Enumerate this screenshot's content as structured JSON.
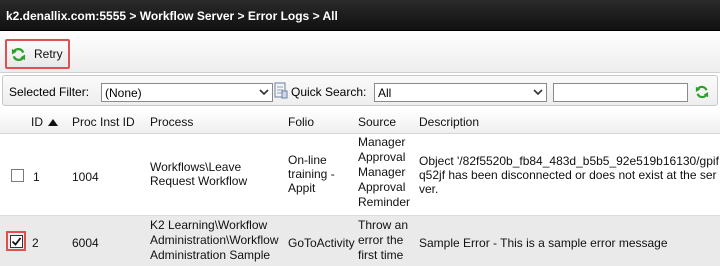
{
  "breadcrumb": "k2.denallix.com:5555 > Workflow Server > Error Logs > All",
  "toolbar": {
    "retry_label": "Retry"
  },
  "filter": {
    "selected_filter_label": "Selected Filter:",
    "selected_filter_value": "(None)",
    "quick_search_label": "Quick Search:",
    "quick_search_scope": "All",
    "quick_search_text": ""
  },
  "columns": [
    "ID",
    "Proc Inst ID",
    "Process",
    "Folio",
    "Source",
    "Description"
  ],
  "rows": [
    {
      "checked": false,
      "id": "1",
      "proc_inst_id": "1004",
      "process": "Workflows\\Leave Request Workflow",
      "folio": "On-line training - Appit",
      "source": "Manager Approval Manager Approval Reminder",
      "description": "Object '/82f5520b_fb84_483d_b5b5_92e519b16130/gpifq52jf has been disconnected or does not exist at the server."
    },
    {
      "checked": true,
      "id": "2",
      "proc_inst_id": "6004",
      "process": "K2 Learning\\Workflow Administration\\Workflow Administration Sample",
      "folio": "GoToActivity",
      "source": "Throw an error the first time",
      "description": "Sample Error - This is a sample error message"
    }
  ],
  "colors": {
    "highlight": "#e05050",
    "refresh_green": "#2aa02a",
    "title_bg": "#1a1a1a"
  }
}
